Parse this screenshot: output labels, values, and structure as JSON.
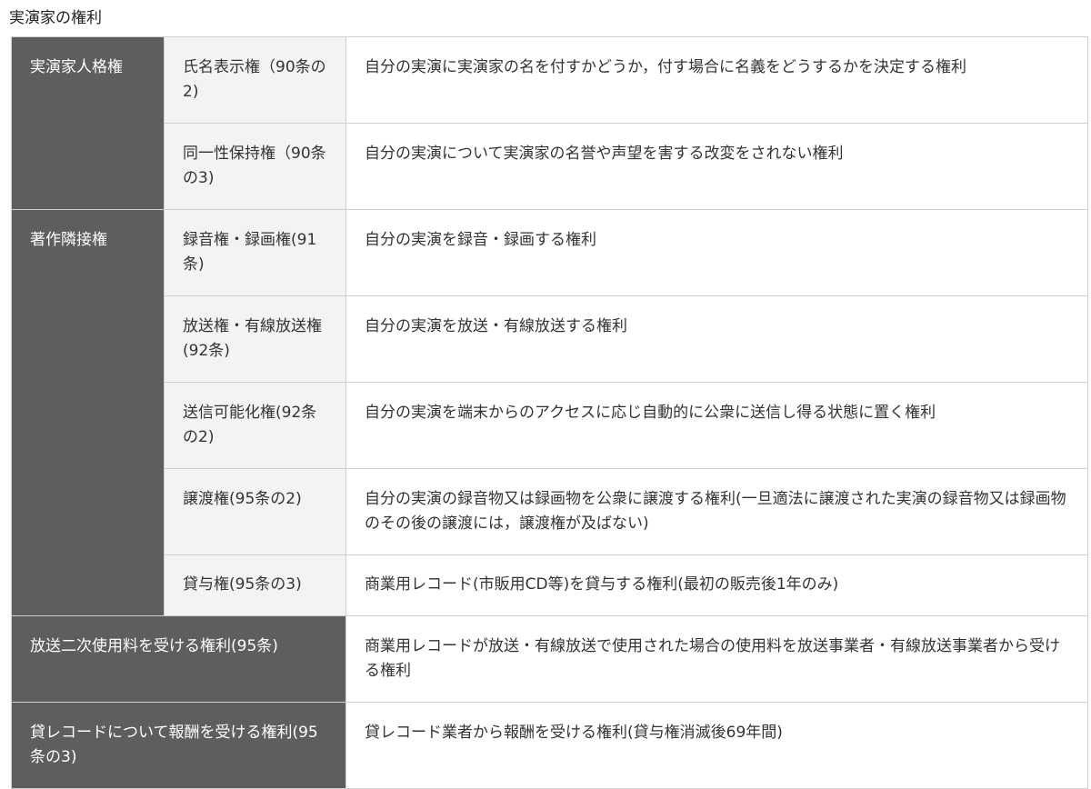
{
  "caption": "実演家の権利",
  "table": {
    "rows": [
      {
        "category": "実演家人格権",
        "sub": "氏名表示権（90条の2)",
        "desc": "自分の実演に実演家の名を付すかどうか，付す場合に名義をどうするかを決定する権利"
      },
      {
        "sub": "同一性保持権（90条の3)",
        "desc": "自分の実演について実演家の名誉や声望を害する改変をされない権利"
      },
      {
        "category": "著作隣接権",
        "sub": "録音権・録画権(91条)",
        "desc": "自分の実演を録音・録画する権利"
      },
      {
        "sub": "放送権・有線放送権(92条)",
        "desc": "自分の実演を放送・有線放送する権利"
      },
      {
        "sub": "送信可能化権(92条の2)",
        "desc": "自分の実演を端末からのアクセスに応じ自動的に公衆に送信し得る状態に置く権利"
      },
      {
        "sub": "譲渡権(95条の2)",
        "desc": "自分の実演の録音物又は録画物を公衆に譲渡する権利(一旦適法に譲渡された実演の録音物又は録画物のその後の譲渡には，譲渡権が及ばない)"
      },
      {
        "sub": "貸与権(95条の3)",
        "desc": "商業用レコード(市販用CD等)を貸与する権利(最初の販売後1年のみ)"
      },
      {
        "category": "放送二次使用料を受ける権利(95条)",
        "desc": "商業用レコードが放送・有線放送で使用された場合の使用料を放送事業者・有線放送事業者から受ける権利"
      },
      {
        "category": "貸レコードについて報酬を受ける権利(95条の3)",
        "desc": "貸レコード業者から報酬を受ける権利(貸与権消滅後69年間)"
      }
    ]
  },
  "colors": {
    "category_bg": "#5e5e5e",
    "sub_bg": "#f3f3f3",
    "border": "#cfcfcf",
    "text": "#333333"
  }
}
